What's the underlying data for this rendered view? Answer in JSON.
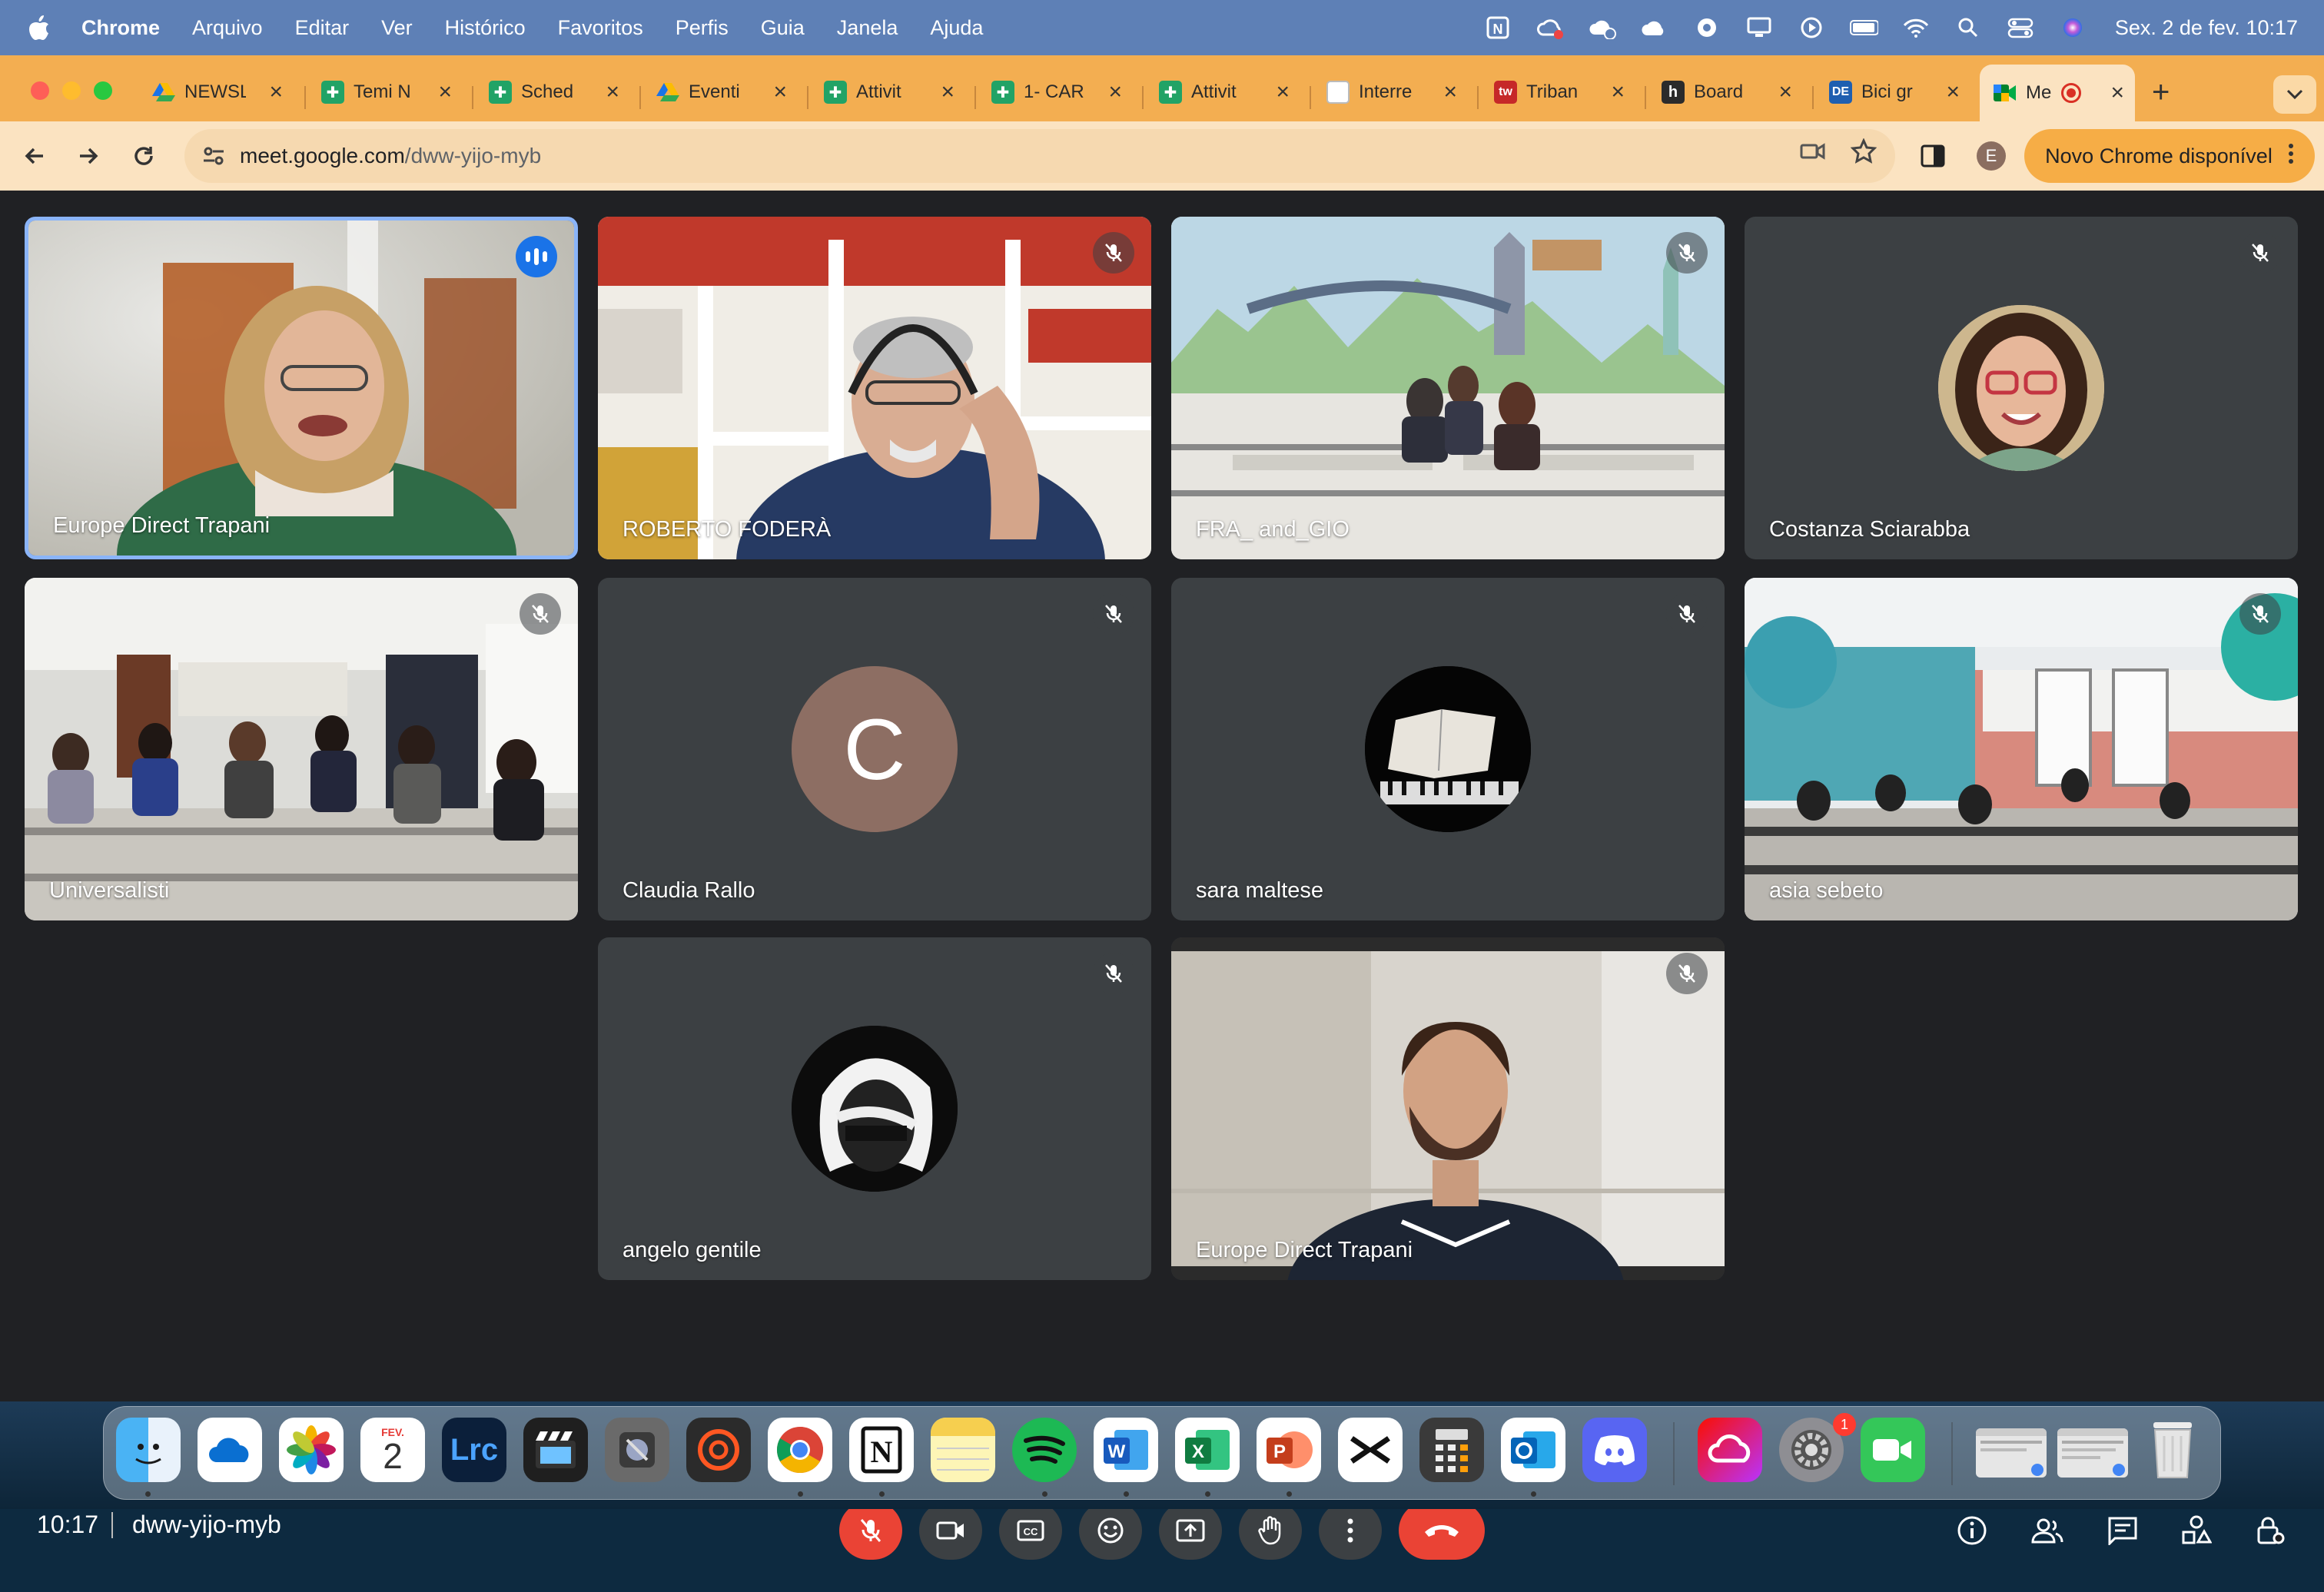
{
  "menubar": {
    "app": "Chrome",
    "items": [
      "Arquivo",
      "Editar",
      "Ver",
      "Histórico",
      "Favoritos",
      "Perfis",
      "Guia",
      "Janela",
      "Ajuda"
    ],
    "clock": "Sex. 2 de fev.  10:17",
    "status_icons": [
      "notion-icon",
      "creative-cloud-icon",
      "cloud-sync-icon",
      "cloud-icon",
      "record-icon",
      "display-icon",
      "play-icon",
      "battery-icon",
      "wifi-icon",
      "search-icon",
      "control-center-icon",
      "siri-icon"
    ]
  },
  "tabs": [
    {
      "label": "NEWSL",
      "icon": "google-drive-icon"
    },
    {
      "label": "Temi N",
      "icon": "google-sheets-icon"
    },
    {
      "label": "Sched",
      "icon": "google-sheets-icon"
    },
    {
      "label": "Eventi",
      "icon": "google-drive-icon"
    },
    {
      "label": "Attivit",
      "icon": "google-sheets-icon"
    },
    {
      "label": "1- CAR",
      "icon": "google-sheets-icon"
    },
    {
      "label": "Attivit",
      "icon": "google-sheets-icon"
    },
    {
      "label": "Interre",
      "icon": "page-icon"
    },
    {
      "label": "Triban",
      "icon": "tw-icon"
    },
    {
      "label": "Board",
      "icon": "h-icon"
    },
    {
      "label": "Bici gr",
      "icon": "de-icon"
    },
    {
      "label": "Me",
      "icon": "google-meet-icon",
      "active": true
    }
  ],
  "toolbar": {
    "url_host": "meet.google.com",
    "url_path": "/dww-yijo-myb",
    "profile_initial": "E",
    "update_label": "Novo Chrome disponível"
  },
  "participants": [
    {
      "name": "Europe Direct Trapani",
      "muted": false,
      "speaking": true,
      "kind": "video"
    },
    {
      "name": "ROBERTO FODERÀ",
      "muted": true,
      "kind": "video"
    },
    {
      "name": "FRA_ and_GIO",
      "muted": true,
      "kind": "video"
    },
    {
      "name": "Costanza Sciarabba",
      "muted": true,
      "kind": "photo-avatar"
    },
    {
      "name": "Universalisti",
      "muted": true,
      "kind": "video"
    },
    {
      "name": "Claudia Rallo",
      "muted": true,
      "kind": "letter-avatar",
      "initial": "C"
    },
    {
      "name": "sara maltese",
      "muted": true,
      "kind": "photo-avatar"
    },
    {
      "name": "asia sebeto",
      "muted": true,
      "kind": "video"
    },
    {
      "name": "angelo gentile",
      "muted": true,
      "kind": "photo-avatar"
    },
    {
      "name": "Europe Direct Trapani",
      "muted": true,
      "kind": "video"
    }
  ],
  "meeting": {
    "time": "10:17",
    "code": "dww-yijo-myb",
    "participant_count": "10"
  },
  "dock": {
    "calendar_month": "FEV.",
    "calendar_day": "2",
    "lrc_label": "Lrc",
    "settings_badge": "1"
  },
  "colors": {
    "menubar": "#5e80b6",
    "tabbar": "#f3ae51",
    "toolbar": "#fbe3c1",
    "meet_bg": "#202124",
    "tile_bg": "#3c4043",
    "hangup": "#ea4335",
    "speaking_border": "#8ab4f8"
  }
}
